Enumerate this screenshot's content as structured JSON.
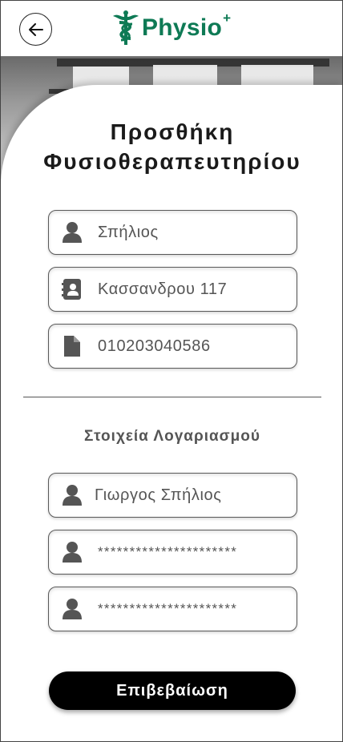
{
  "header": {
    "back_icon": "arrow-left-icon",
    "logo_text": "Physio",
    "logo_superscript": "+",
    "brand_color": "#0e7a55"
  },
  "form": {
    "title_line1": "Προσθήκη",
    "title_line2": "Φυσιοθεραπευτηρίου",
    "clinic_fields": [
      {
        "icon": "person-icon",
        "value": "Σπήλιος"
      },
      {
        "icon": "address-book-icon",
        "value": "Κασσανδρου 117"
      },
      {
        "icon": "document-icon",
        "value": "010203040586"
      }
    ],
    "account_section_title": "Στοιχεία Λογαριασμού",
    "account_fields": [
      {
        "icon": "person-icon",
        "value": "Γιωργος Σπήλιος"
      },
      {
        "icon": "person-icon",
        "value": "**********************"
      },
      {
        "icon": "person-icon",
        "value": "**********************"
      }
    ],
    "submit_label": "Επιβεβαίωση"
  },
  "colors": {
    "button_bg": "#000000",
    "icon_gray": "#555555",
    "field_text": "#555555"
  }
}
